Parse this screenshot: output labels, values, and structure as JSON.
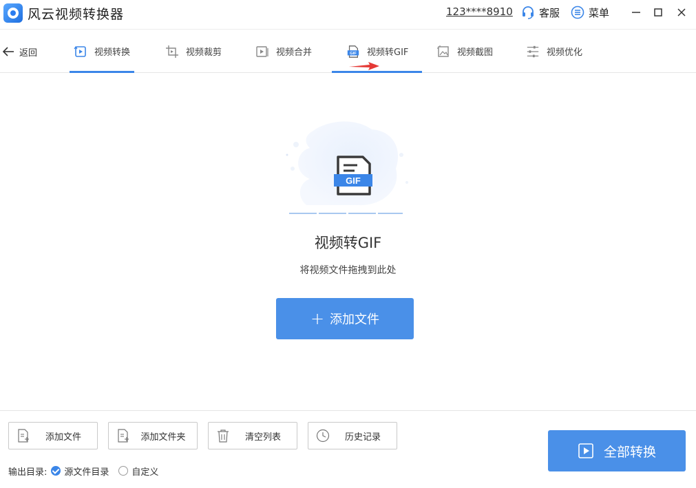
{
  "app": {
    "title": "风云视频转换器",
    "account": "123****8910",
    "service_label": "客服",
    "menu_label": "菜单"
  },
  "nav": {
    "back_label": "返回",
    "tabs": [
      {
        "label": "视频转换",
        "icon": "video-convert-icon",
        "active": false
      },
      {
        "label": "视频裁剪",
        "icon": "video-crop-icon",
        "active": false
      },
      {
        "label": "视频合并",
        "icon": "video-merge-icon",
        "active": false
      },
      {
        "label": "视频转GIF",
        "icon": "gif-icon",
        "active": true
      },
      {
        "label": "视频截图",
        "icon": "screenshot-icon",
        "active": false
      },
      {
        "label": "视频优化",
        "icon": "optimize-icon",
        "active": false
      }
    ]
  },
  "main": {
    "illustration_badge": "GIF",
    "title": "视频转GIF",
    "hint": "将视频文件拖拽到此处",
    "add_file_label": "添加文件"
  },
  "toolbar": {
    "add_file": "添加文件",
    "add_folder": "添加文件夹",
    "clear_list": "清空列表",
    "history": "历史记录"
  },
  "output": {
    "label": "输出目录:",
    "option_source": "源文件目录",
    "option_custom": "自定义",
    "selected": "源文件目录"
  },
  "convert_all_label": "全部转换",
  "colors": {
    "accent": "#4a90e8",
    "active_underline": "#3b86e8",
    "arrow": "#e53935"
  }
}
